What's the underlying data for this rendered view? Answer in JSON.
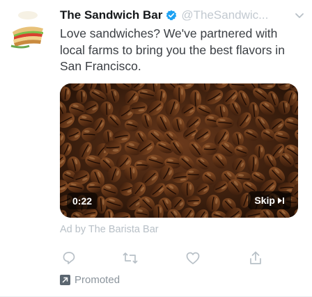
{
  "tweet": {
    "account_name": "The Sandwich Bar",
    "handle": "@TheSandwic...",
    "text": "Love sandwiches? We've partnered with local farms to bring you the best flavors in San Francisco.",
    "video": {
      "time": "0:22",
      "skip_label": "Skip"
    },
    "ad_by": "Ad by The Barista Bar",
    "promoted_label": "Promoted"
  },
  "colors": {
    "verified_blue": "#1da1f2",
    "icon_gray": "#b8c0c7",
    "video_bg": "#2a1608"
  },
  "icons": {
    "verified": "verified-badge-icon",
    "menu": "chevron-down-icon",
    "reply": "reply-icon",
    "retweet": "retweet-icon",
    "like": "heart-icon",
    "share": "share-icon",
    "promoted": "promoted-icon",
    "skip": "skip-icon"
  }
}
